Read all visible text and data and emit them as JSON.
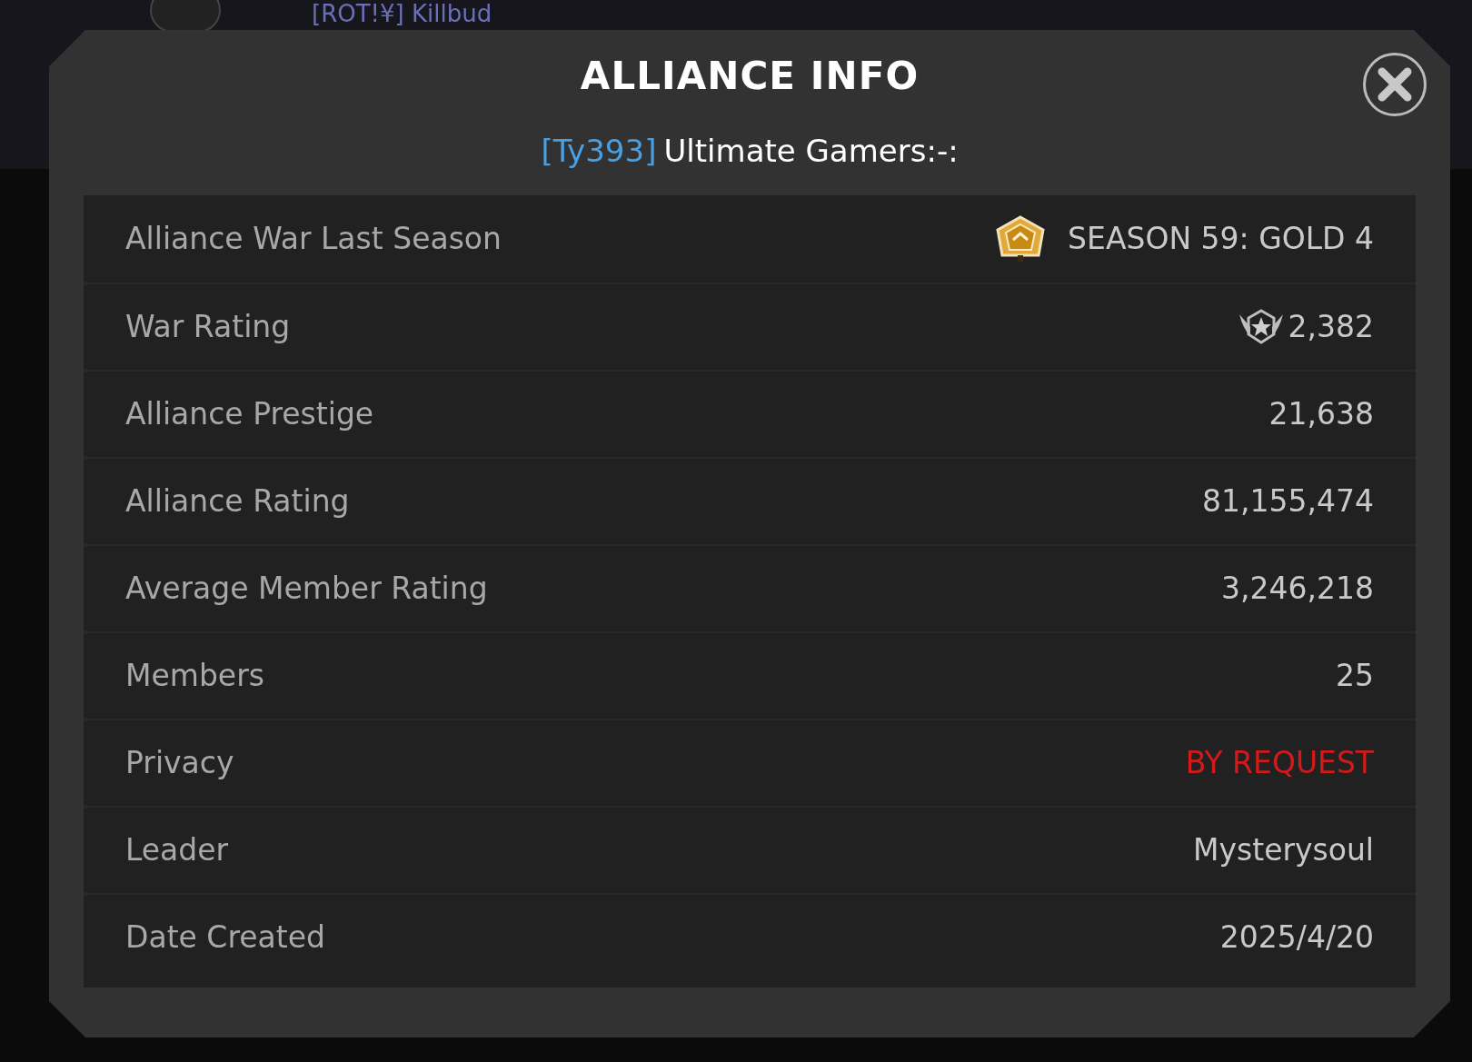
{
  "background": {
    "player_tag": "[ROT!¥] Killbud"
  },
  "dialog": {
    "title": "ALLIANCE INFO",
    "tag": "[Ty393]",
    "name": "Ultimate Gamers:-:",
    "rows": [
      {
        "kind": "season",
        "label": "Alliance War Last Season",
        "value": "SEASON 59: GOLD 4"
      },
      {
        "kind": "war",
        "label": "War Rating",
        "value": "2,382"
      },
      {
        "kind": "text",
        "label": "Alliance Prestige",
        "value": "21,638"
      },
      {
        "kind": "text",
        "label": "Alliance Rating",
        "value": "81,155,474"
      },
      {
        "kind": "text",
        "label": "Average Member Rating",
        "value": "3,246,218"
      },
      {
        "kind": "text",
        "label": "Members",
        "value": "25"
      },
      {
        "kind": "warning",
        "label": "Privacy",
        "value": "BY REQUEST"
      },
      {
        "kind": "text",
        "label": "Leader",
        "value": "Mysterysoul"
      },
      {
        "kind": "text",
        "label": "Date Created",
        "value": "2025/4/20"
      }
    ]
  }
}
